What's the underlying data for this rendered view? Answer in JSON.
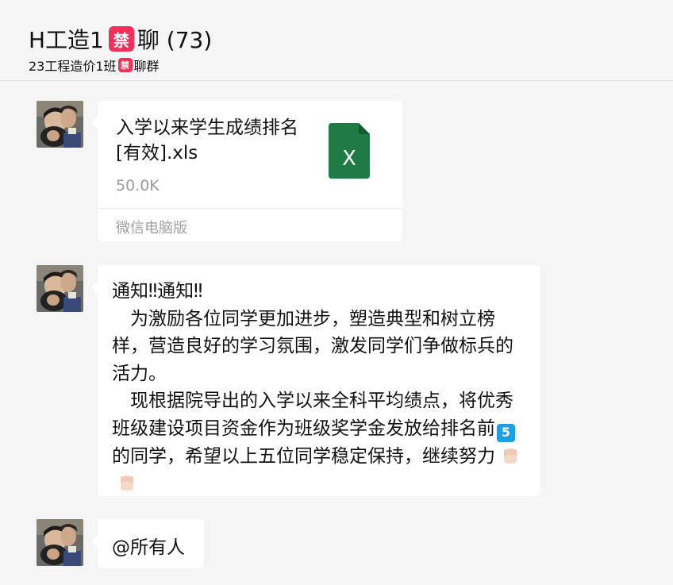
{
  "header": {
    "title_prefix": "H工造1",
    "title_ban_icon": "禁",
    "title_suffix": "聊 (73)",
    "subtitle_prefix": "23工程造价1班",
    "subtitle_ban_icon": "禁",
    "subtitle_suffix": "聊群"
  },
  "messages": [
    {
      "type": "file",
      "avatar": "user-avatar",
      "file_name": "入学以来学生成绩排名[有效].xls",
      "file_size": "50.0K",
      "file_icon": "excel-file-icon",
      "file_icon_letter": "X",
      "footer": "微信电脑版"
    },
    {
      "type": "text",
      "avatar": "user-avatar",
      "line1": "通知‼通知‼",
      "para1": "　为激励各位同学更加进步，塑造典型和树立榜样，营造良好的学习氛围，激发同学们争做标兵的活力。",
      "para2_before": "　现根据院导出的入学以来全科平均绩点，将优秀班级建设项目资金作为班级奖学金发放给排名前",
      "para2_badge": "5",
      "para2_after": "的同学，希望以上五位同学稳定保持，继续努力",
      "emoji": [
        "fist-emoji",
        "fist-emoji"
      ]
    },
    {
      "type": "text",
      "avatar": "user-avatar",
      "text": "@所有人"
    }
  ],
  "colors": {
    "background": "#f5f5f5",
    "bubble": "#ffffff",
    "ban_badge": "#f2315a",
    "excel_green": "#1f7a45",
    "number_badge": "#1e9de3"
  }
}
